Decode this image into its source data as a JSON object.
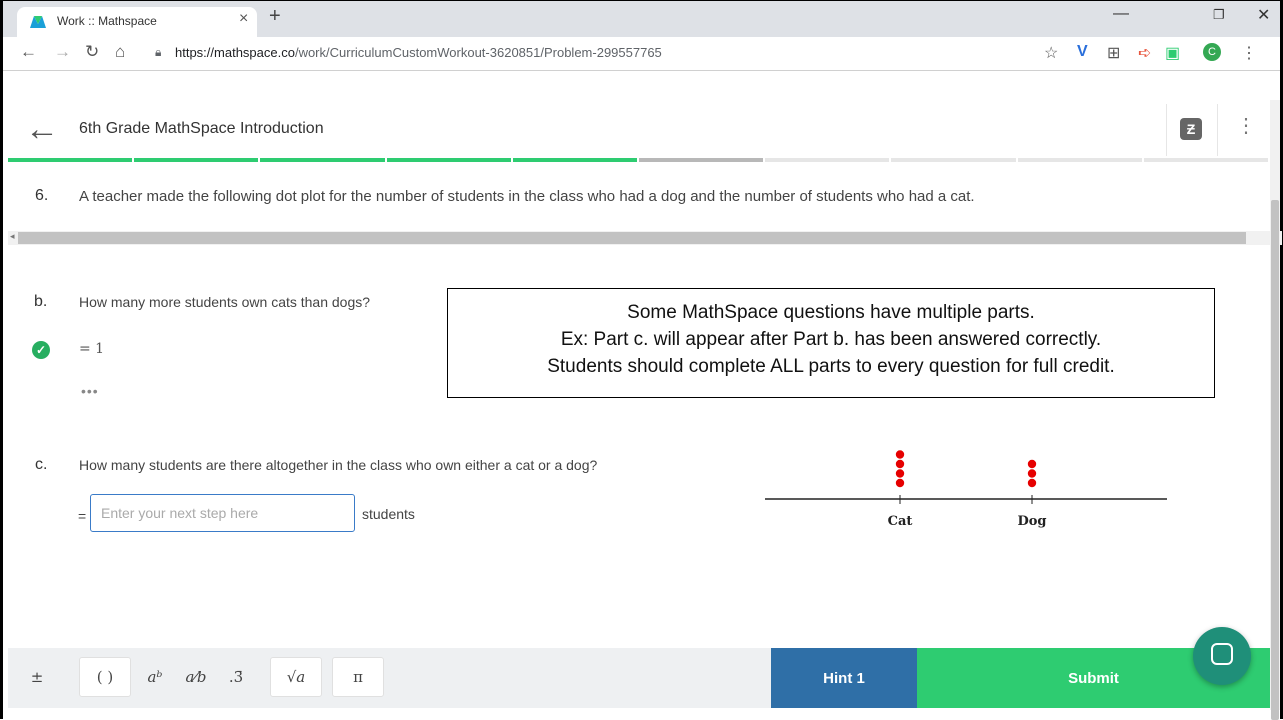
{
  "browser": {
    "tab_title": "Work :: Mathspace",
    "tab_close": "×",
    "new_tab": "+",
    "url_host": "https://mathspace.co",
    "url_path": "/work/CurriculumCustomWorkout-3620851/Problem-299557765",
    "profile_initial": "C",
    "icons": [
      "back-icon",
      "forward-icon",
      "reload-icon",
      "home-icon",
      "lock-icon",
      "star-icon",
      "minimize-icon",
      "restore-icon",
      "close-icon"
    ]
  },
  "app": {
    "title": "6th Grade MathSpace Introduction",
    "progress": {
      "segments": 10,
      "completed": 5,
      "current": 6,
      "colors": {
        "completed": "#2ecc71",
        "current": "#b8b8b8",
        "remaining": "#e6e6e6"
      }
    }
  },
  "question": {
    "number": "6.",
    "text": "A teacher made the following dot plot for the number of students in the class who had a dog and the number of students who had a cat."
  },
  "part_b": {
    "label": "b.",
    "question": "How many more students own cats than dogs?",
    "answer": "= 1",
    "more": "•••"
  },
  "callout": {
    "line1": "Some MathSpace questions have multiple parts.",
    "line2": "Ex: Part c. will appear after Part b. has been answered correctly.",
    "line3": "Students should complete ALL parts to every question for full credit."
  },
  "part_c": {
    "label": "c.",
    "question": "How many students are there altogether in the class who own either a cat or a dog?",
    "equals": "=",
    "placeholder": "Enter your next step here",
    "unit": "students"
  },
  "chart_data": {
    "type": "scatter",
    "categories": [
      "Cat",
      "Dog"
    ],
    "values": [
      4,
      3
    ],
    "title": "",
    "xlabel": "",
    "ylabel": ""
  },
  "keypad": {
    "plusminus": "±",
    "parens": "( )",
    "power": "aᵇ",
    "fraction": "a⁄b",
    "recurring": ".3̄",
    "sqrt": "√a",
    "pi": "π"
  },
  "actions": {
    "hint": "Hint 1",
    "submit": "Submit"
  }
}
